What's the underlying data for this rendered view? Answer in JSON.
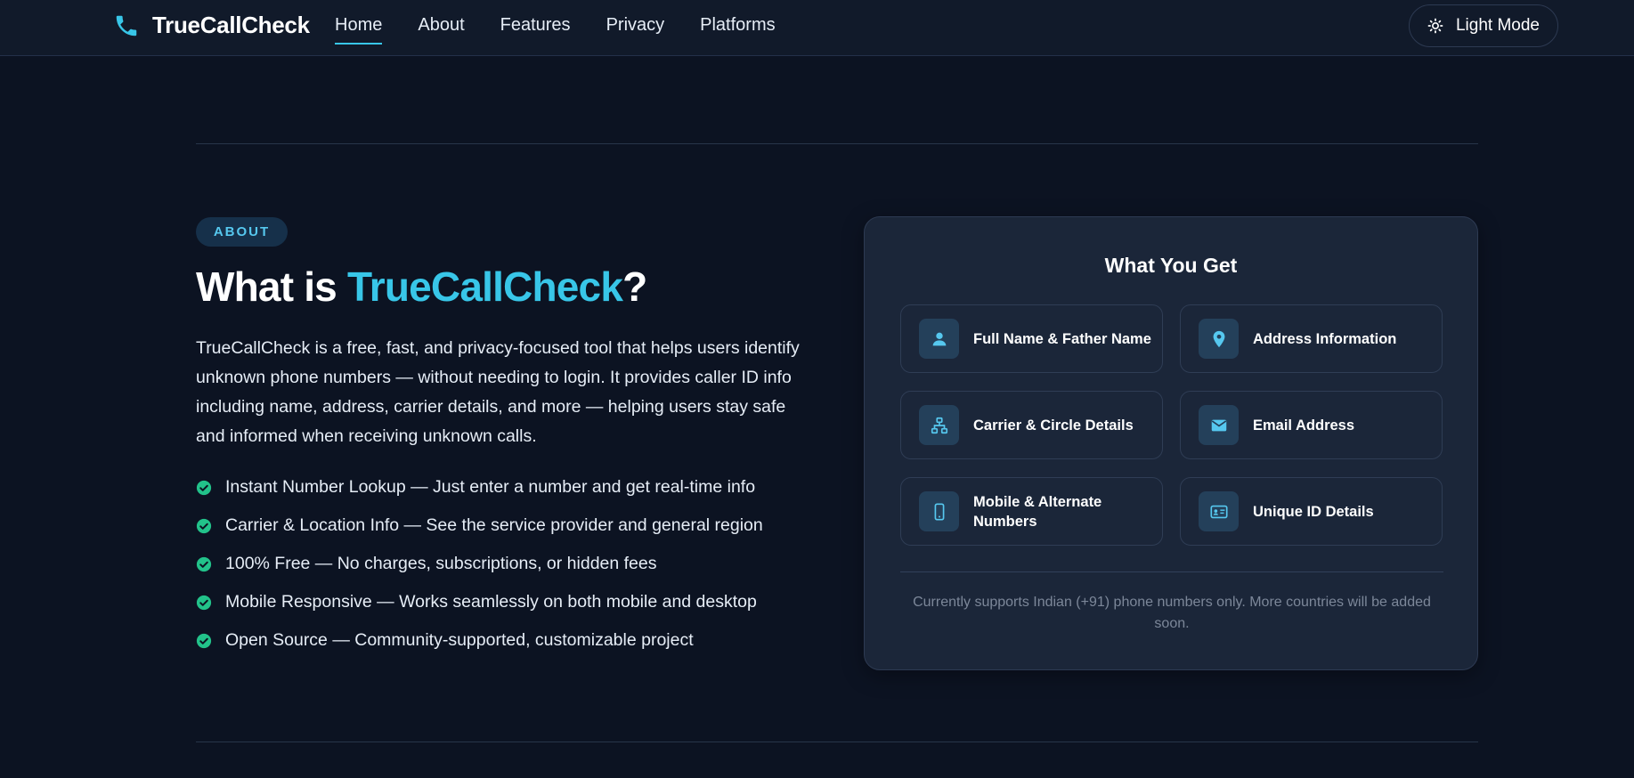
{
  "nav": {
    "brand": "TrueCallCheck",
    "links": [
      {
        "label": "Home",
        "active": true
      },
      {
        "label": "About",
        "active": false
      },
      {
        "label": "Features",
        "active": false
      },
      {
        "label": "Privacy",
        "active": false
      },
      {
        "label": "Platforms",
        "active": false
      }
    ],
    "mode_button": "Light Mode",
    "brand_icon": "phone-icon",
    "mode_icon": "sun-icon"
  },
  "about": {
    "badge": "ABOUT",
    "heading_prefix": "What is ",
    "heading_accent": "TrueCallCheck",
    "heading_suffix": "?",
    "description": "TrueCallCheck is a free, fast, and privacy-focused tool that helps users identify unknown phone numbers — without needing to login. It provides caller ID info including name, address, carrier details, and more — helping users stay safe and informed when receiving unknown calls.",
    "features": [
      "Instant Number Lookup — Just enter a number and get real-time info",
      "Carrier & Location Info — See the service provider and general region",
      "100% Free — No charges, subscriptions, or hidden fees",
      "Mobile Responsive — Works seamlessly on both mobile and desktop",
      "Open Source — Community-supported, customizable project"
    ]
  },
  "card": {
    "title": "What You Get",
    "items": [
      {
        "label": "Full Name & Father Name",
        "icon": "user-icon"
      },
      {
        "label": "Address Information",
        "icon": "map-pin-icon"
      },
      {
        "label": "Carrier & Circle Details",
        "icon": "network-icon"
      },
      {
        "label": "Email Address",
        "icon": "envelope-icon"
      },
      {
        "label": "Mobile & Alternate Numbers",
        "icon": "mobile-icon"
      },
      {
        "label": "Unique ID Details",
        "icon": "id-card-icon"
      }
    ],
    "note": "Currently supports Indian (+91) phone numbers only. More countries will be added soon."
  },
  "colors": {
    "background": "#0c1322",
    "accent": "#38c6e8",
    "check": "#22c28a",
    "card": "#1b2639"
  }
}
